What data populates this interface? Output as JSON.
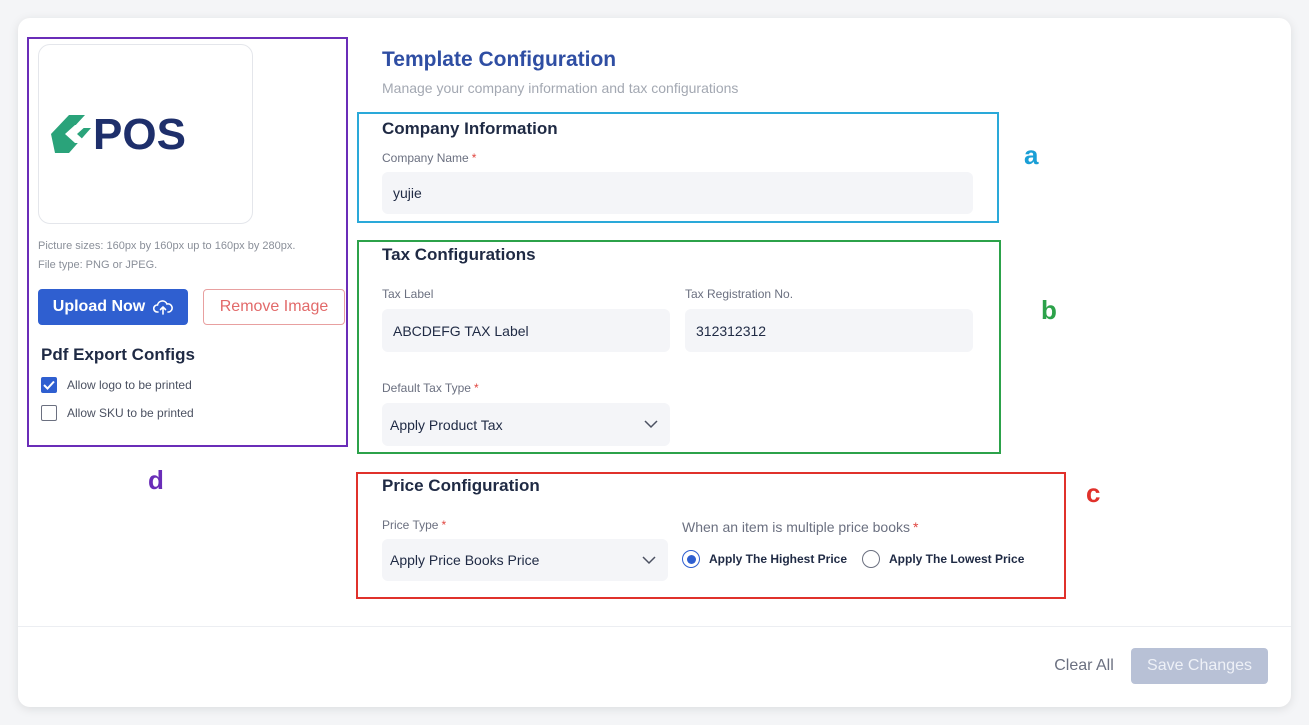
{
  "header": {
    "title": "Template Configuration",
    "subtitle": "Manage your company information and tax configurations"
  },
  "logo_panel": {
    "logo_text": "POS",
    "picture_sizes": "Picture sizes: 160px by 160px up to 160px by 280px.",
    "file_type": "File type: PNG or JPEG.",
    "upload_label": "Upload Now",
    "remove_label": "Remove Image",
    "pdf_title": "Pdf Export Configs",
    "options": [
      {
        "label": "Allow logo to be printed",
        "checked": true
      },
      {
        "label": "Allow SKU to be printed",
        "checked": false
      }
    ]
  },
  "company": {
    "title": "Company Information",
    "name_label": "Company Name",
    "name_value": "yujie"
  },
  "tax": {
    "title": "Tax Configurations",
    "label_label": "Tax Label",
    "label_value": "ABCDEFG TAX Label",
    "reg_label": "Tax Registration No.",
    "reg_value": "312312312",
    "type_label": "Default Tax Type",
    "type_value": "Apply Product Tax"
  },
  "price": {
    "title": "Price Configuration",
    "type_label": "Price Type",
    "type_value": "Apply Price Books Price",
    "multi_label": "When an item is multiple price books",
    "options": [
      {
        "label": "Apply The Highest Price",
        "selected": true
      },
      {
        "label": "Apply The Lowest Price",
        "selected": false
      }
    ]
  },
  "annotations": {
    "a": "a",
    "b": "b",
    "c": "c",
    "d": "d"
  },
  "footer": {
    "clear_label": "Clear All",
    "save_label": "Save Changes"
  },
  "colors": {
    "primary": "#2f5fd0",
    "box_a": "#2aa9d9",
    "box_b": "#2ca24a",
    "box_c": "#e0312b",
    "box_d": "#6a2db8"
  }
}
